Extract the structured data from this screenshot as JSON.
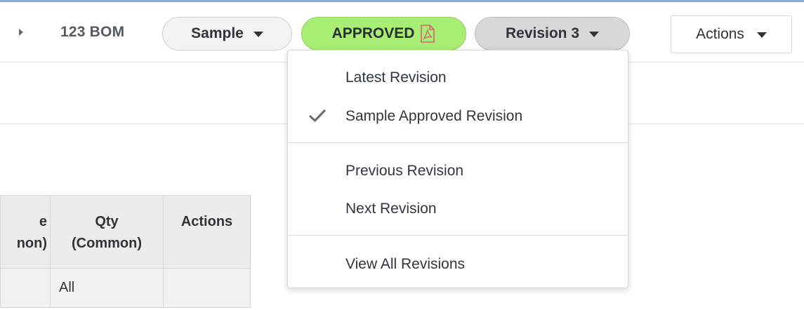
{
  "header": {
    "record_title": "123 BOM",
    "sample_pill": "Sample",
    "status_pill": "APPROVED",
    "revision_pill": "Revision 3",
    "actions_label": "Actions"
  },
  "revision_menu": {
    "items": [
      {
        "label": "Latest Revision",
        "checked": false
      },
      {
        "label": "Sample Approved Revision",
        "checked": true
      },
      {
        "label": "Previous Revision",
        "checked": false
      },
      {
        "label": "Next Revision",
        "checked": false
      },
      {
        "label": "View All Revisions",
        "checked": false
      }
    ]
  },
  "bom_table": {
    "headers": {
      "partial_line1": "e",
      "partial_line2": "non)",
      "qty_line1": "Qty",
      "qty_line2": "(Common)",
      "actions": "Actions"
    },
    "rows": [
      {
        "partial": "",
        "qty": "All",
        "actions": ""
      }
    ]
  },
  "colors": {
    "approved_pill_bg": "#a8ed74",
    "revision_pill_bg": "#d8d8d8",
    "sample_pill_bg": "#f3f3f3",
    "top_accent": "#8aa9d8"
  },
  "icons": {
    "status_pill_icon": "pdf-icon",
    "checked_item_icon": "check-icon"
  }
}
